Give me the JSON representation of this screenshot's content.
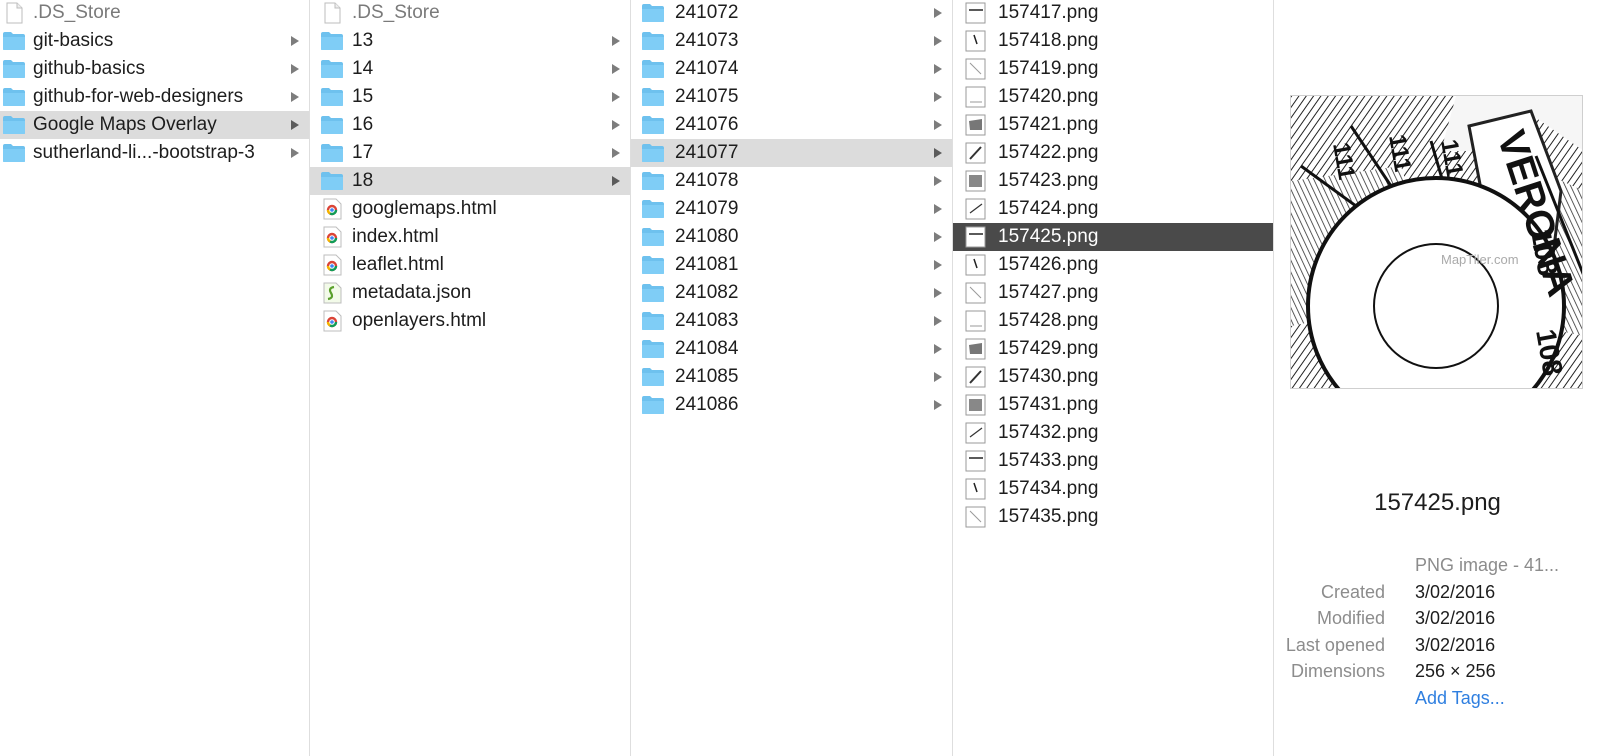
{
  "columns": [
    {
      "items": [
        {
          "name": ".DS_Store",
          "type": "file",
          "dim": true
        },
        {
          "name": "git-basics",
          "type": "folder"
        },
        {
          "name": "github-basics",
          "type": "folder"
        },
        {
          "name": "github-for-web-designers",
          "type": "folder"
        },
        {
          "name": "Google Maps Overlay",
          "type": "folder",
          "state": "path"
        },
        {
          "name": "sutherland-li...-bootstrap-3",
          "type": "folder"
        }
      ]
    },
    {
      "items": [
        {
          "name": ".DS_Store",
          "type": "file",
          "dim": true
        },
        {
          "name": "13",
          "type": "folder"
        },
        {
          "name": "14",
          "type": "folder"
        },
        {
          "name": "15",
          "type": "folder"
        },
        {
          "name": "16",
          "type": "folder"
        },
        {
          "name": "17",
          "type": "folder"
        },
        {
          "name": "18",
          "type": "folder",
          "state": "path"
        },
        {
          "name": "googlemaps.html",
          "type": "html"
        },
        {
          "name": "index.html",
          "type": "html"
        },
        {
          "name": "leaflet.html",
          "type": "html"
        },
        {
          "name": "metadata.json",
          "type": "json"
        },
        {
          "name": "openlayers.html",
          "type": "html"
        }
      ]
    },
    {
      "items": [
        {
          "name": "241072",
          "type": "folder"
        },
        {
          "name": "241073",
          "type": "folder"
        },
        {
          "name": "241074",
          "type": "folder"
        },
        {
          "name": "241075",
          "type": "folder"
        },
        {
          "name": "241076",
          "type": "folder"
        },
        {
          "name": "241077",
          "type": "folder",
          "state": "path"
        },
        {
          "name": "241078",
          "type": "folder"
        },
        {
          "name": "241079",
          "type": "folder"
        },
        {
          "name": "241080",
          "type": "folder"
        },
        {
          "name": "241081",
          "type": "folder"
        },
        {
          "name": "241082",
          "type": "folder"
        },
        {
          "name": "241083",
          "type": "folder"
        },
        {
          "name": "241084",
          "type": "folder"
        },
        {
          "name": "241085",
          "type": "folder"
        },
        {
          "name": "241086",
          "type": "folder"
        }
      ]
    },
    {
      "items": [
        {
          "name": "157417.png",
          "type": "image"
        },
        {
          "name": "157418.png",
          "type": "image"
        },
        {
          "name": "157419.png",
          "type": "image"
        },
        {
          "name": "157420.png",
          "type": "image"
        },
        {
          "name": "157421.png",
          "type": "image"
        },
        {
          "name": "157422.png",
          "type": "image"
        },
        {
          "name": "157423.png",
          "type": "image"
        },
        {
          "name": "157424.png",
          "type": "image"
        },
        {
          "name": "157425.png",
          "type": "image",
          "state": "selected"
        },
        {
          "name": "157426.png",
          "type": "image"
        },
        {
          "name": "157427.png",
          "type": "image"
        },
        {
          "name": "157428.png",
          "type": "image"
        },
        {
          "name": "157429.png",
          "type": "image"
        },
        {
          "name": "157430.png",
          "type": "image"
        },
        {
          "name": "157431.png",
          "type": "image"
        },
        {
          "name": "157432.png",
          "type": "image"
        },
        {
          "name": "157433.png",
          "type": "image"
        },
        {
          "name": "157434.png",
          "type": "image"
        },
        {
          "name": "157435.png",
          "type": "image"
        }
      ]
    }
  ],
  "preview": {
    "filename": "157425.png",
    "image": {
      "street": "VERONA",
      "watermark": "MapTiler.com",
      "numbers": [
        "108",
        "108",
        "111",
        "111",
        "111"
      ]
    },
    "kind": "PNG image - 41...",
    "fields": [
      {
        "key": "Created",
        "value": "3/02/2016"
      },
      {
        "key": "Modified",
        "value": "3/02/2016"
      },
      {
        "key": "Last opened",
        "value": "3/02/2016"
      },
      {
        "key": "Dimensions",
        "value": "256 × 256"
      }
    ],
    "add_tags": "Add Tags..."
  },
  "colors": {
    "folder": "#7fcdf6",
    "folder_tab": "#6ec1ee",
    "path_selection": "#dcdcdc",
    "selection": "#4a4a4a",
    "link": "#2f7fe0"
  },
  "icons": {
    "folder": "folder-icon",
    "file": "document-icon",
    "html": "chrome-html-icon",
    "json": "json-script-icon",
    "image": "image-thumbnail-icon",
    "chevron": "chevron-right-icon"
  }
}
